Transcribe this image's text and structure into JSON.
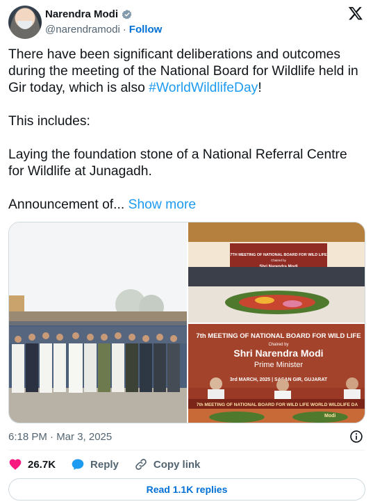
{
  "author": {
    "name": "Narendra Modi",
    "handle": "@narendramodi",
    "separator": "·",
    "follow_label": "Follow"
  },
  "tweet": {
    "para1_before": "There have been significant deliberations and outcomes during the meeting of the National Board for Wildlife held in Gir today, which is also ",
    "hashtag": "#WorldWildlifeDay",
    "para1_after": "!",
    "para2": "This includes:",
    "para3": "Laying the foundation stone of a National Referral Centre for Wildlife at Junagadh.",
    "para4": "Announcement of...",
    "show_more": "Show more"
  },
  "media": {
    "image2": {
      "banner_line1": "7TH MEETING OF NATIONAL BOARD FOR WILD LIFE",
      "banner_line2": "Chaired by",
      "banner_line3": "Shri Narendra Modi"
    },
    "image3": {
      "line1": "7th MEETING OF NATIONAL BOARD FOR WILD LIFE",
      "line2": "Chaired by",
      "line3": "Shri Narendra Modi",
      "line4": "Prime Minister",
      "line5": "3rd MARCH, 2025 | SASAN GIR, GUJARAT",
      "line6": "7th MEETING OF NATIONAL BOARD FOR WILD LIFE  WORLD WILDLIFE DA",
      "line7": "Modi"
    }
  },
  "meta": {
    "timestamp": "6:18 PM · Mar 3, 2025"
  },
  "actions": {
    "likes": "26.7K",
    "reply": "Reply",
    "copy_link": "Copy link"
  },
  "read_replies": "Read 1.1K replies",
  "colors": {
    "accent": "#1d9bf0",
    "like": "#f91880",
    "link": "#006fd6",
    "muted": "#536471"
  }
}
